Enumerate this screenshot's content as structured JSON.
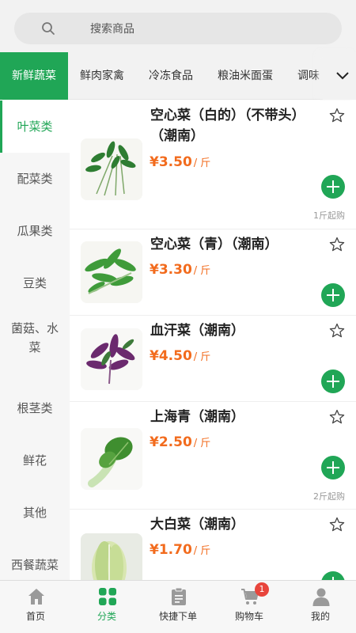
{
  "search": {
    "placeholder": "搜索商品"
  },
  "tabs": [
    {
      "label": "新鲜蔬菜",
      "active": true
    },
    {
      "label": "鲜肉家禽"
    },
    {
      "label": "冷冻食品"
    },
    {
      "label": "粮油米面蛋"
    },
    {
      "label": "调味"
    }
  ],
  "sidebar": {
    "items": [
      {
        "label": "叶菜类",
        "active": true
      },
      {
        "label": "配菜类"
      },
      {
        "label": "瓜果类"
      },
      {
        "label": "豆类"
      },
      {
        "label_line1": "菌菇、水",
        "label_line2": "菜"
      },
      {
        "label": "根茎类"
      },
      {
        "label": "鲜花"
      },
      {
        "label": "其他"
      },
      {
        "label": "西餐蔬菜"
      }
    ]
  },
  "products": [
    {
      "name": "空心菜（白的）（不带头）（潮南）",
      "price": "¥3.50",
      "unit": "/ 斤",
      "min_buy": "1斤起购"
    },
    {
      "name": "空心菜（青）（潮南）",
      "price": "¥3.30",
      "unit": "/ 斤"
    },
    {
      "name": "血汗菜（潮南）",
      "price": "¥4.50",
      "unit": "/ 斤"
    },
    {
      "name": "上海青（潮南）",
      "price": "¥2.50",
      "unit": "/ 斤",
      "min_buy": "2斤起购"
    },
    {
      "name": "大白菜（潮南）",
      "price": "¥1.70",
      "unit": "/ 斤"
    }
  ],
  "bottom_nav": [
    {
      "label": "首页",
      "icon": "home-icon"
    },
    {
      "label": "分类",
      "icon": "category-icon",
      "active": true
    },
    {
      "label": "快捷下单",
      "icon": "quick-order-icon"
    },
    {
      "label": "购物车",
      "icon": "cart-icon",
      "badge": "1"
    },
    {
      "label": "我的",
      "icon": "user-icon"
    }
  ],
  "colors": {
    "accent": "#20a656",
    "price": "#f26b1d",
    "badge": "#e8453c"
  }
}
